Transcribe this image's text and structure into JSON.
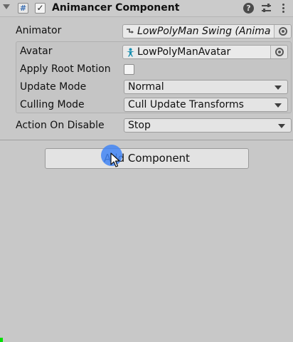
{
  "header": {
    "title": "Animancer Component",
    "script_glyph": "#",
    "enabled_glyph": "✓",
    "help_glyph": "?"
  },
  "inspector": {
    "animator": {
      "label": "Animator",
      "value": "LowPolyMan Swing (Anima"
    },
    "avatar": {
      "label": "Avatar",
      "value": "LowPolyManAvatar"
    },
    "apply_root_motion": {
      "label": "Apply Root Motion",
      "checked": false
    },
    "update_mode": {
      "label": "Update Mode",
      "value": "Normal"
    },
    "culling_mode": {
      "label": "Culling Mode",
      "value": "Cull Update Transforms"
    },
    "action_on_disable": {
      "label": "Action On Disable",
      "value": "Stop"
    }
  },
  "footer": {
    "add_component_label": "Add Component"
  },
  "icons": {
    "foldout": "foldout-arrow-icon",
    "script": "script-icon",
    "help": "help-icon",
    "presets": "presets-icon",
    "menu": "kebab-menu-icon",
    "animator": "animator-controller-icon",
    "avatar": "avatar-figure-icon",
    "picker": "object-picker-icon"
  },
  "colors": {
    "click_highlight": "#4285f4",
    "avatar_icon": "#1a8fb0"
  }
}
